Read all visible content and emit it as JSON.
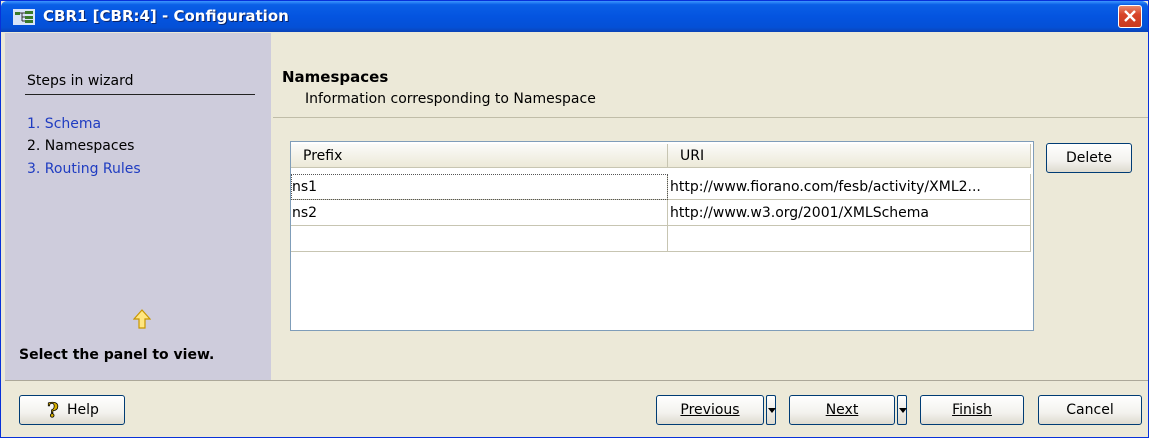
{
  "window": {
    "title": "CBR1 [CBR:4] - Configuration"
  },
  "sidebar": {
    "title": "Steps in wizard",
    "steps": [
      {
        "label": "1. Schema"
      },
      {
        "label": "2. Namespaces"
      },
      {
        "label": "3. Routing Rules"
      }
    ],
    "hint": "Select the panel to view."
  },
  "header": {
    "title": "Namespaces",
    "subtitle": "Information corresponding to Namespace"
  },
  "table": {
    "columns": [
      "Prefix",
      "URI"
    ],
    "rows": [
      [
        "ns1",
        "http://www.fiorano.com/fesb/activity/XML2..."
      ],
      [
        "ns2",
        "http://www.w3.org/2001/XMLSchema"
      ],
      [
        "",
        ""
      ]
    ]
  },
  "buttons": {
    "delete": "Delete",
    "help": "Help",
    "previous": "Previous",
    "next": "Next",
    "finish": "Finish",
    "cancel": "Cancel"
  },
  "colors": {
    "titlebar": "#0454e0",
    "sidebar_bg": "#ceccdc",
    "link": "#1f3cc1",
    "window_bg": "#ece9d8"
  }
}
